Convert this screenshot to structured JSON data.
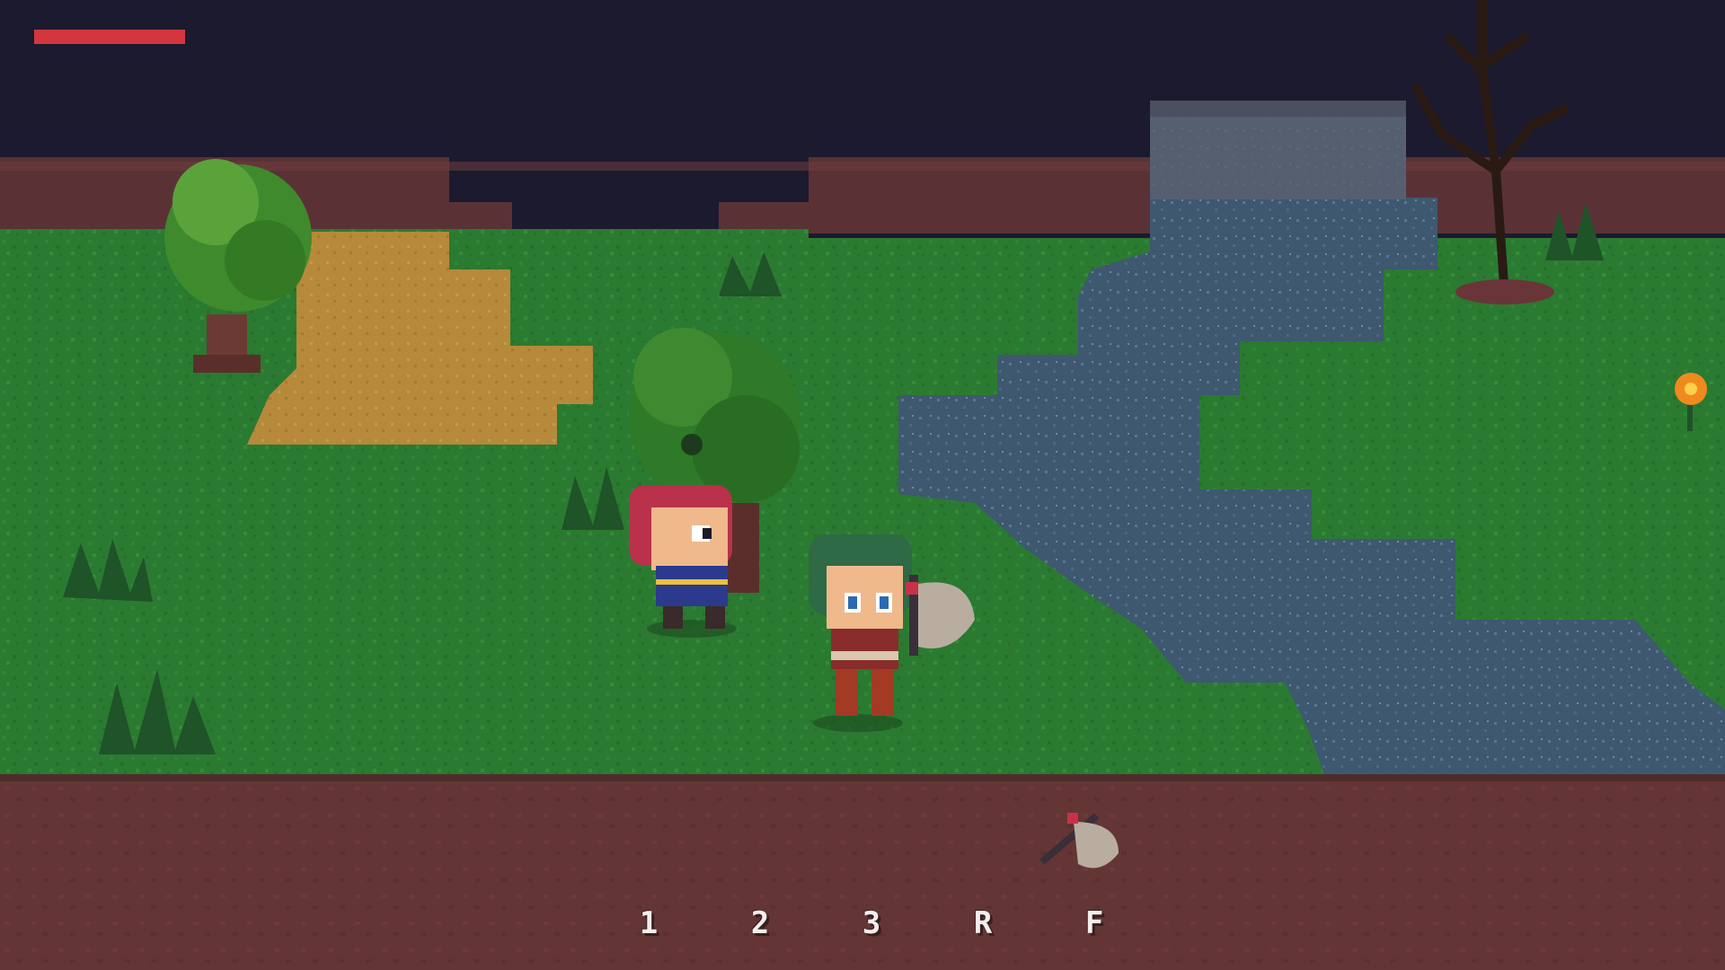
{
  "hud": {
    "health": {
      "value": 1.0,
      "color": "#d3363e"
    }
  },
  "hotbar": {
    "keys": [
      {
        "label": "1"
      },
      {
        "label": "2"
      },
      {
        "label": "3"
      },
      {
        "label": "R"
      },
      {
        "label": "F"
      }
    ]
  },
  "world": {
    "ground_item": {
      "icon": "axe-icon"
    }
  },
  "palette": {
    "sky": "#1b1a2e",
    "grass": "#2c7a32",
    "dirt": "#663636",
    "sand": "#b98a3a",
    "water": "#3f5a72",
    "accent_flower": "#f08a1e"
  }
}
